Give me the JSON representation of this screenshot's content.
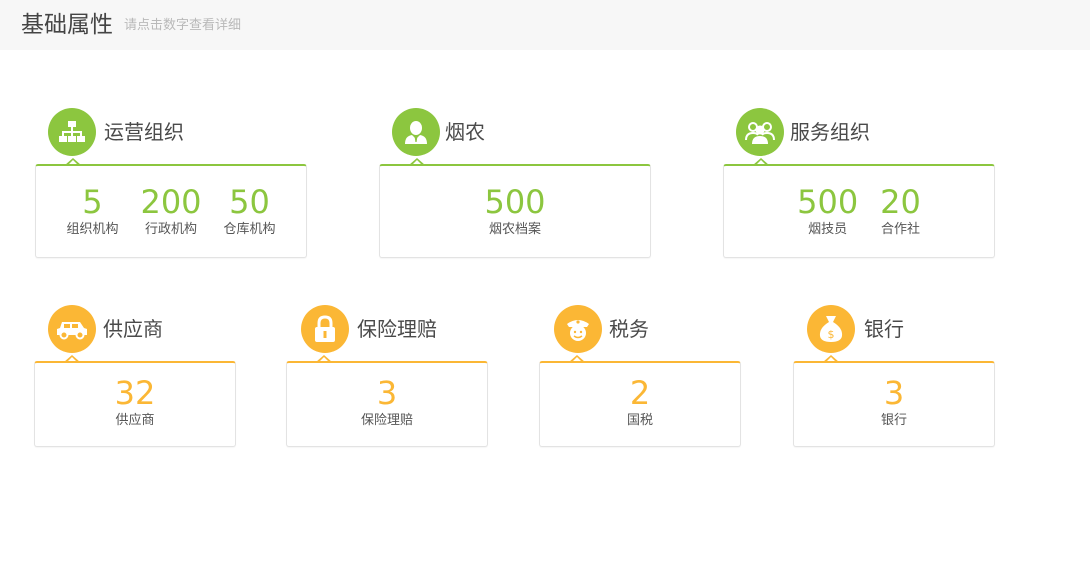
{
  "header": {
    "title": "基础属性",
    "subtitle": "请点击数字查看详细"
  },
  "colors": {
    "green": "#8cc63f",
    "orange": "#fbb735"
  },
  "groups": [
    {
      "title": "运营组织",
      "icon": "org-chart-icon",
      "stats": [
        {
          "value": "5",
          "label": "组织机构"
        },
        {
          "value": "200",
          "label": "行政机构"
        },
        {
          "value": "50",
          "label": "仓库机构"
        }
      ]
    },
    {
      "title": "烟农",
      "icon": "farmer-icon",
      "stats": [
        {
          "value": "500",
          "label": "烟农档案"
        }
      ]
    },
    {
      "title": "服务组织",
      "icon": "people-group-icon",
      "stats": [
        {
          "value": "500",
          "label": "烟技员"
        },
        {
          "value": "20",
          "label": "合作社"
        }
      ]
    },
    {
      "title": "供应商",
      "icon": "car-icon",
      "stats": [
        {
          "value": "32",
          "label": "供应商"
        }
      ]
    },
    {
      "title": "保险理赔",
      "icon": "lock-icon",
      "stats": [
        {
          "value": "3",
          "label": "保险理赔"
        }
      ]
    },
    {
      "title": "税务",
      "icon": "officer-icon",
      "stats": [
        {
          "value": "2",
          "label": "国税"
        }
      ]
    },
    {
      "title": "银行",
      "icon": "money-bag-icon",
      "stats": [
        {
          "value": "3",
          "label": "银行"
        }
      ]
    }
  ]
}
